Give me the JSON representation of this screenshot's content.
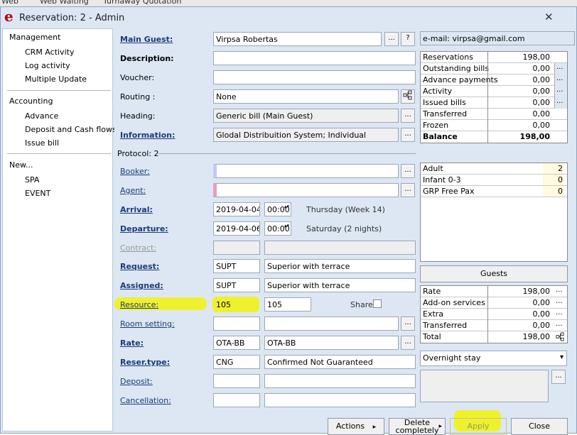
{
  "bg": {
    "t1": "Web",
    "t2": "Web   Waiting",
    "t3": "Turnaway Quotation"
  },
  "window": {
    "title": "Reservation: 2 - Admin"
  },
  "sidebar": {
    "management": "Management",
    "crm": "CRM Activity",
    "log": "Log activity",
    "multi": "Multiple Update",
    "accounting": "Accounting",
    "advance": "Advance",
    "deposit_cash": "Deposit and Cash flows",
    "issue_bill": "Issue bill",
    "new": "New...",
    "spa": "SPA",
    "event": "EVENT"
  },
  "form": {
    "main_guest_label": "Main Guest:",
    "main_guest_value": "Virpsa Robertas",
    "email": "e-mail: virpsa@gmail.com",
    "description_label": "Description:",
    "voucher_label": "Voucher:",
    "routing_label": "Routing :",
    "routing_value": "None",
    "heading_label": "Heading:",
    "heading_value": "Generic bill (Main Guest)",
    "information_label": "Information:",
    "information_value": "Glodal Distribuition System; Individual",
    "protocol": "Protocol: 2",
    "booker_label": "Booker:",
    "agent_label": "Agent:",
    "arrival_label": "Arrival:",
    "arrival_date": "2019-04-04",
    "arrival_time": "00:00",
    "arrival_day": "Thursday (Week 14)",
    "departure_label": "Departure:",
    "departure_date": "2019-04-06",
    "departure_time": "00:00",
    "departure_day": "Saturday (2 nights)",
    "contract_label": "Contract:",
    "request_label": "Request:",
    "request_code": "SUPT",
    "request_desc": "Superior with terrace",
    "assigned_label": "Assigned:",
    "assigned_code": "SUPT",
    "assigned_desc": "Superior with terrace",
    "resource_label": "Resource:",
    "resource_code": "105",
    "resource_value": "105",
    "share_label": "Share",
    "room_setting_label": "Room setting:",
    "rate_label": "Rate:",
    "rate_code": "OTA-BB",
    "rate_desc": "OTA-BB",
    "reser_type_label": "Reser.type:",
    "reser_type_code": "CNG",
    "reser_type_desc": "Confirmed Not Guaranteed",
    "deposit_label": "Deposit:",
    "cancellation_label": "Cancellation:"
  },
  "summary": [
    {
      "label": "Reservations",
      "value": "198,00"
    },
    {
      "label": "Outstanding bills",
      "value": "0,00"
    },
    {
      "label": "Advance payments",
      "value": "0,00"
    },
    {
      "label": "Activity",
      "value": "0,00"
    },
    {
      "label": "Issued bills",
      "value": "0,00"
    },
    {
      "label": "Transferred",
      "value": "0,00"
    },
    {
      "label": "Frozen",
      "value": "0,00"
    },
    {
      "label": "Balance",
      "value": "198,00"
    }
  ],
  "pax": [
    {
      "label": "Adult",
      "value": "2"
    },
    {
      "label": "Infant 0-3",
      "value": "0"
    },
    {
      "label": "GRP Free Pax",
      "value": "0"
    }
  ],
  "guests_button": "Guests",
  "rates": [
    {
      "label": "Rate",
      "value": "198,00"
    },
    {
      "label": "Add-on services",
      "value": "0,00"
    },
    {
      "label": "Extra",
      "value": "0,00"
    },
    {
      "label": "Transferred",
      "value": "0,00"
    },
    {
      "label": "Total",
      "value": "198,00"
    }
  ],
  "stay_select": "Overnight stay",
  "buttons": {
    "actions": "Actions",
    "delete1": "Delete",
    "delete2": "completely",
    "apply": "Apply",
    "close": "Close"
  },
  "glyphs": {
    "dots": "...",
    "q": "?",
    "arrow": "▸",
    "down": "▾",
    "updown": "▴▾",
    "x": "✕"
  },
  "colors": {
    "accent": "#f2f20a",
    "window_bg": "#dce7f3",
    "logo": "#c00000"
  }
}
